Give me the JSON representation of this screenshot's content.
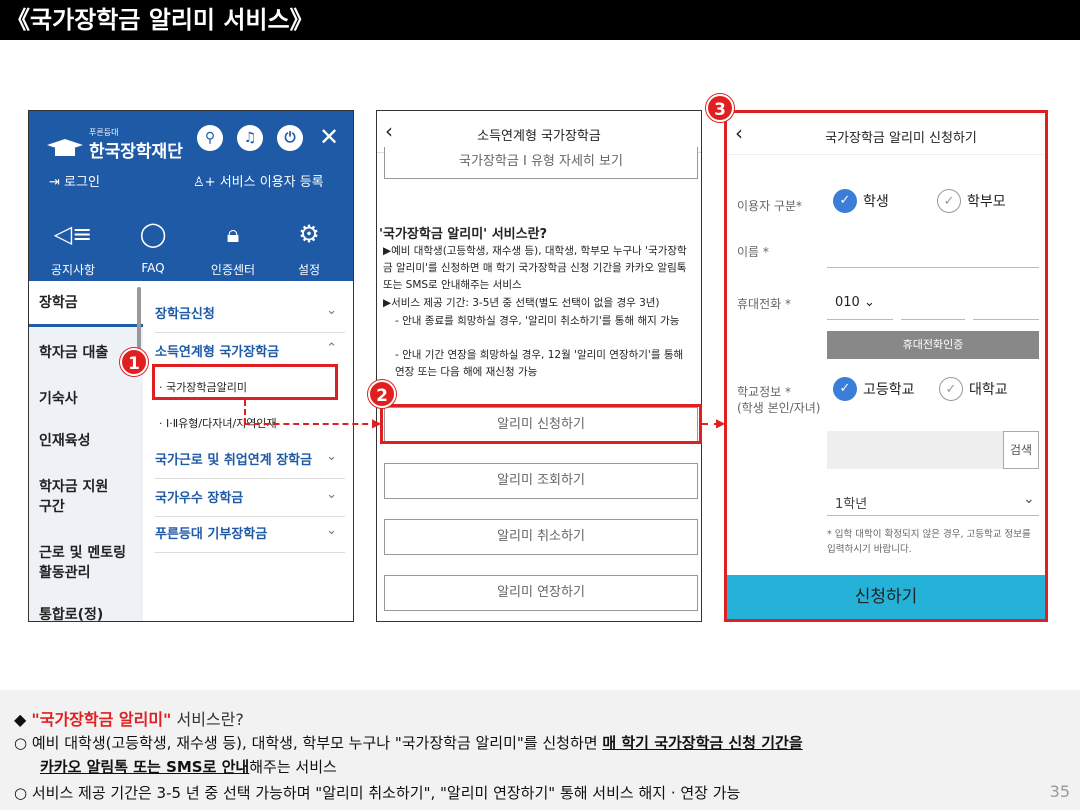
{
  "title": "《국가장학금 알리미 서비스》",
  "screen1": {
    "logo_small": "푸른등대",
    "logo_name": "한국장학재단",
    "login": "로그인",
    "register": "서비스 이용자 등록",
    "icons": [
      {
        "icon": "speaker-icon",
        "label": "공지사항"
      },
      {
        "icon": "chat-icon",
        "label": "FAQ"
      },
      {
        "icon": "lock-icon",
        "label": "인증센터"
      },
      {
        "icon": "gear-icon",
        "label": "설정"
      }
    ],
    "left_nav": [
      "장학금",
      "학자금 대출",
      "기숙사",
      "인재육성",
      "학자금 지원구간",
      "근로 및 멘토링 활동관리",
      "통합로(정)"
    ],
    "sub_nav": [
      "장학금신청",
      "소득연계형 국가장학금",
      "국가근로 및 취업연계 장학금",
      "국가우수 장학금",
      "푸른등대 기부장학금"
    ],
    "sub_items": [
      "· 국가장학금알리미",
      "· Ⅰ·Ⅱ유형/다자녀/지역인재"
    ]
  },
  "screen2": {
    "title": "소득연계형 국가장학금",
    "detail_btn": "국가장학금 I 유형 자세히 보기",
    "heading": "'국가장학금 알리미' 서비스란?",
    "para1": "▶예비 대학생(고등학생, 재수생 등), 대학생, 학부모 누구나 '국가장학금 알리미'를 신청하면 매 학기 국가장학금 신청 기간을 카카오 알림톡 또는 SMS로 안내해주는 서비스",
    "para2": "▶서비스 제공 기간: 3-5년 중 선택(별도 선택이 없을 경우 3년)",
    "para3": "- 안내 종료를 희망하실 경우, '알리미 취소하기'를 통해 해지 가능",
    "para4": "- 안내 기간 연장을 희망하실 경우, 12월 '알리미 연장하기'를 통해 연장 또는 다음 해에 재신청 가능",
    "buttons": [
      "알리미 신청하기",
      "알리미 조회하기",
      "알리미 취소하기",
      "알리미 연장하기"
    ]
  },
  "screen3": {
    "title": "국가장학금 알리미 신청하기",
    "user_type_label": "이용자 구분*",
    "user_type_options": [
      "학생",
      "학부모"
    ],
    "name_label": "이름 *",
    "phone_label": "휴대전화 *",
    "phone_prefix": "010",
    "phone_auth": "휴대전화인증",
    "school_label": "학교정보 *",
    "school_label2": "(학생 본인/자녀)",
    "school_options": [
      "고등학교",
      "대학교"
    ],
    "search_btn": "검색",
    "grade": "1학년",
    "note": "* 입학 대학이 확정되지 않은 경우, 고등학교 정보를 입력하시기 바랍니다.",
    "submit": "신청하기"
  },
  "badges": [
    "1",
    "2",
    "3"
  ],
  "bottom": {
    "line1_a": "◆ ",
    "line1_b": "\"국가장학금 알리미\"",
    "line1_c": " 서비스란?",
    "line2_a": "○ 예비 대학생(고등학생, 재수생 등), 대학생, 학부모 누구나 \"국가장학금 알리미\"를 신청하면 ",
    "line2_b": "매 학기 국가장학금 신청 기간을",
    "line3_a": "카카오 알림톡 또는 SMS로 안내",
    "line3_b": "해주는 서비스",
    "line4": "○ 서비스 제공 기간은 3-5 년 중 선택 가능하며 \"알리미 취소하기\", \"알리미 연장하기\" 통해 서비스 해지 · 연장 가능"
  },
  "page_number": "35"
}
